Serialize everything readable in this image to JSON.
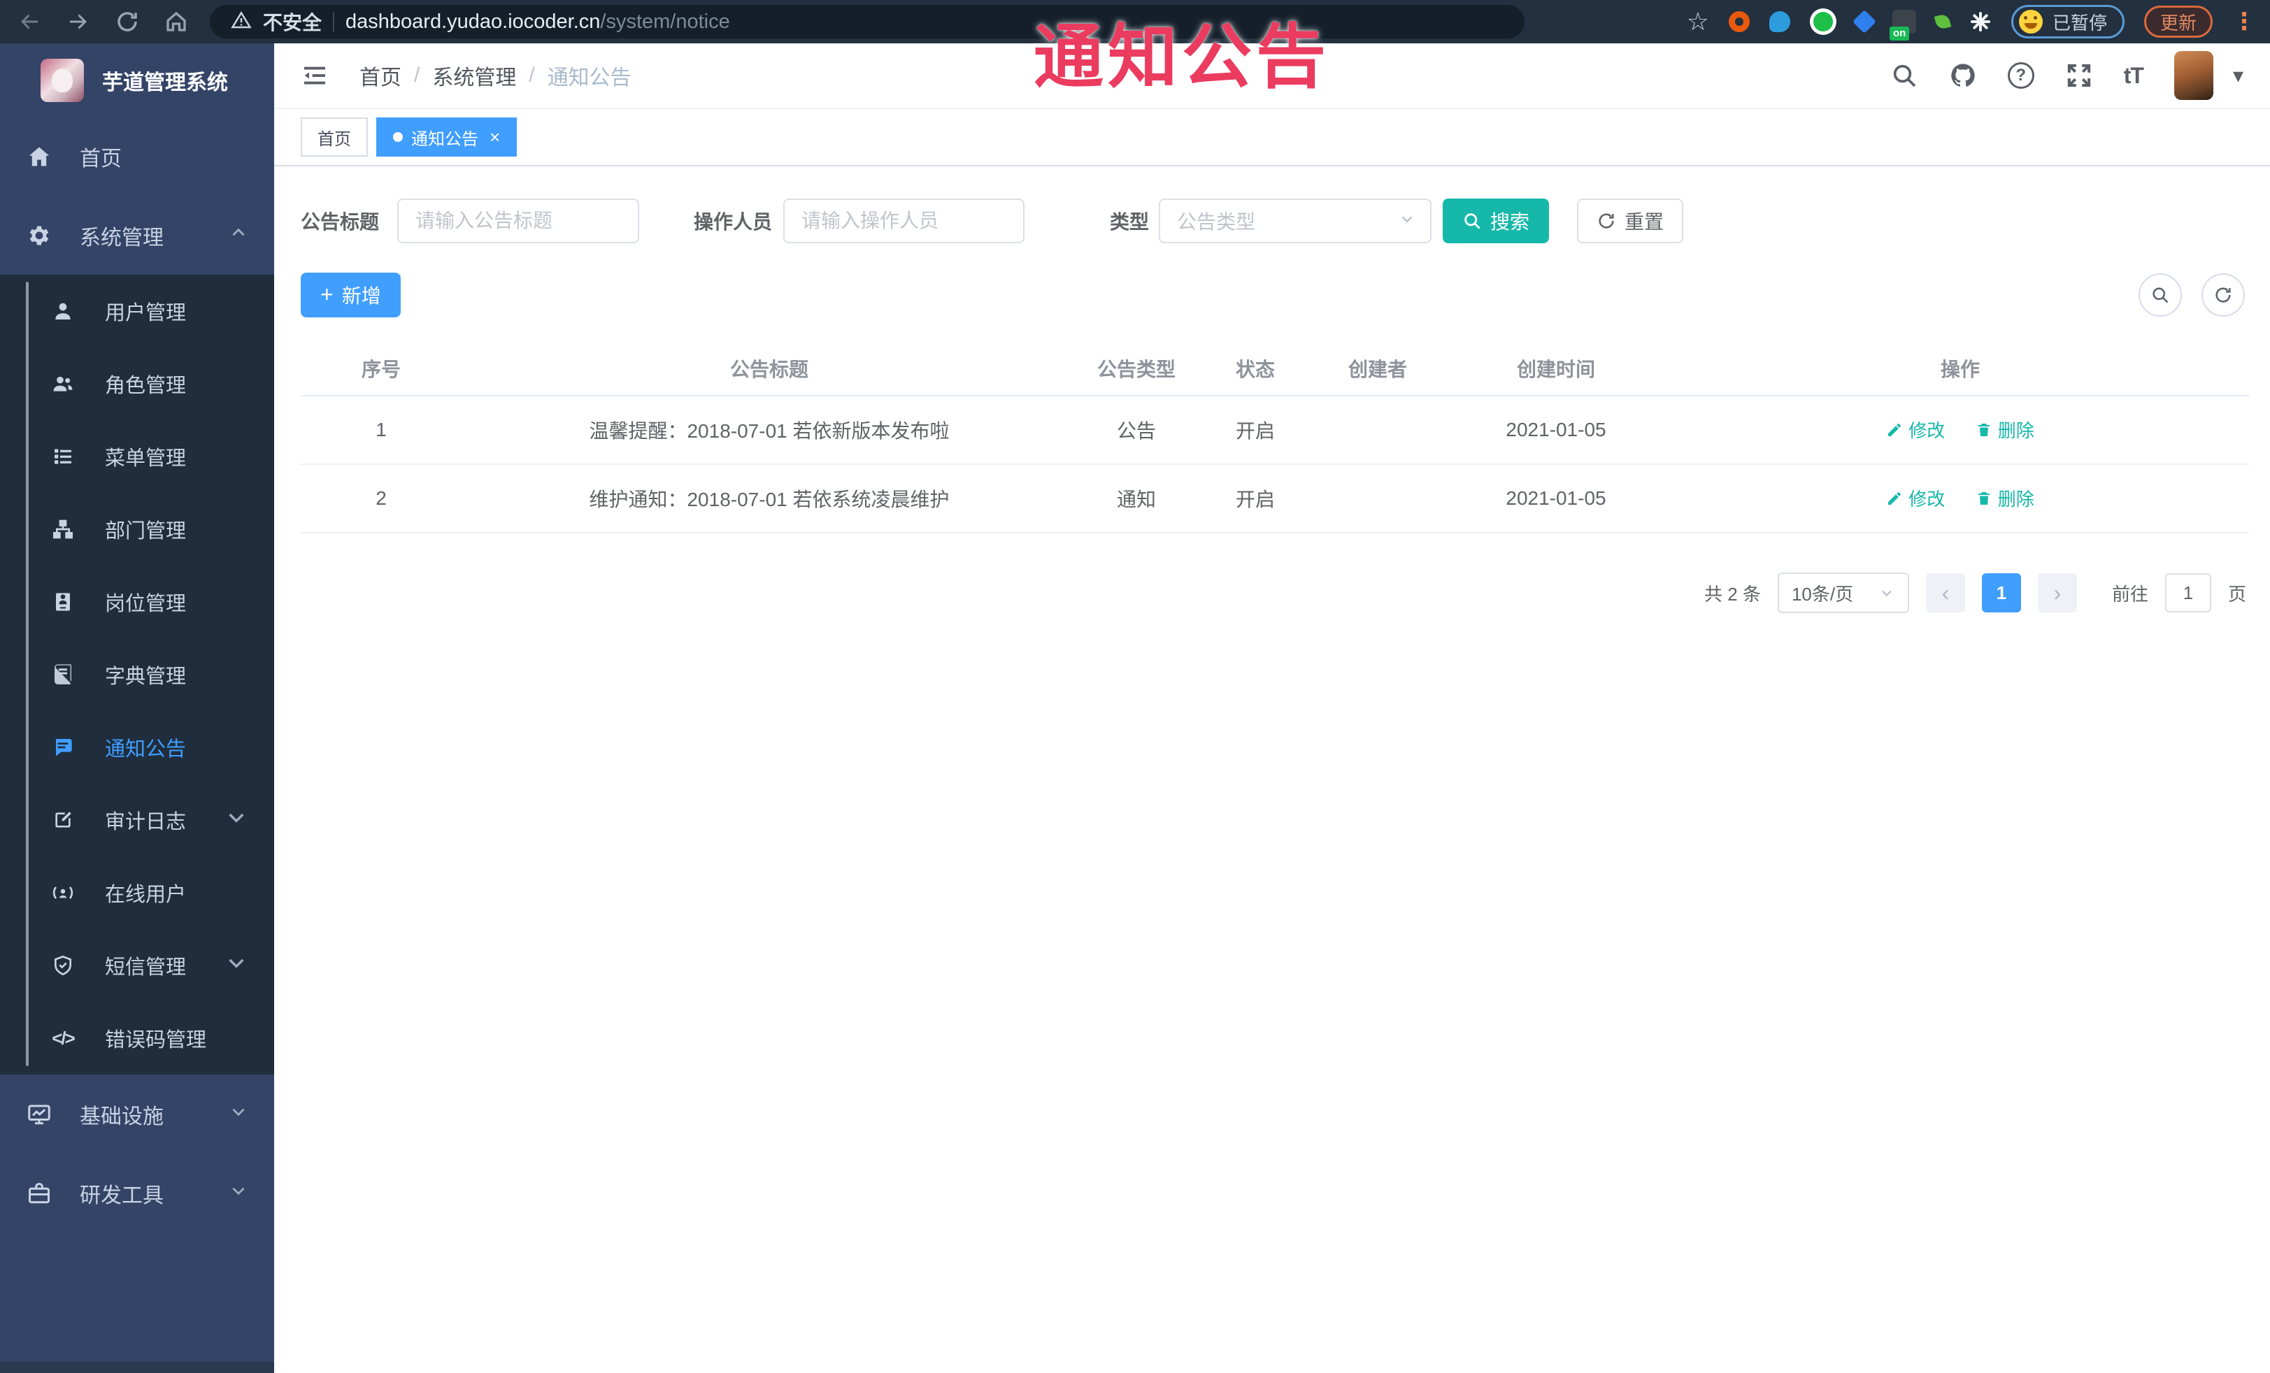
{
  "overlay": {
    "text": "通知公告"
  },
  "browser": {
    "security_label": "不安全",
    "url_host": "dashboard.yudao.iocoder.cn",
    "url_path": "/system/notice",
    "extension_badge": "on",
    "paused_label": "已暂停",
    "update_label": "更新"
  },
  "glyphs": {
    "star": "☆",
    "dots": "⋮",
    "question": "?",
    "font_size": "tT",
    "caret_down": "▾",
    "close": "×",
    "plus": "+",
    "prev": "‹",
    "next": "›",
    "code": "</>",
    "crumb_sep": "/"
  },
  "app": {
    "title": "芋道管理系统"
  },
  "sidebar": {
    "home": "首页",
    "system": "系统管理",
    "sub": [
      "用户管理",
      "角色管理",
      "菜单管理",
      "部门管理",
      "岗位管理",
      "字典管理",
      "通知公告",
      "审计日志",
      "在线用户",
      "短信管理",
      "错误码管理"
    ],
    "infra": "基础设施",
    "devtools": "研发工具"
  },
  "breadcrumb": [
    "首页",
    "系统管理",
    "通知公告"
  ],
  "tabs": [
    {
      "label": "首页"
    },
    {
      "label": "通知公告"
    }
  ],
  "filters": {
    "title_label": "公告标题",
    "title_placeholder": "请输入公告标题",
    "operator_label": "操作人员",
    "operator_placeholder": "请输入操作人员",
    "type_label": "类型",
    "type_placeholder": "公告类型",
    "search_label": "搜索",
    "reset_label": "重置"
  },
  "toolbar": {
    "add_label": "新增"
  },
  "table": {
    "headers": [
      "序号",
      "公告标题",
      "公告类型",
      "状态",
      "创建者",
      "创建时间",
      "操作"
    ],
    "rows": [
      {
        "no": "1",
        "title": "温馨提醒：2018-07-01 若依新版本发布啦",
        "type": "公告",
        "status": "开启",
        "creator": "",
        "created": "2021-01-05",
        "edit": "修改",
        "delete": "删除"
      },
      {
        "no": "2",
        "title": "维护通知：2018-07-01 若依系统凌晨维护",
        "type": "通知",
        "status": "开启",
        "creator": "",
        "created": "2021-01-05",
        "edit": "修改",
        "delete": "删除"
      }
    ]
  },
  "pagination": {
    "total": "共 2 条",
    "page_size": "10条/页",
    "current": "1",
    "goto_label": "前往",
    "goto_value": "1",
    "unit": "页"
  },
  "colors": {
    "primary": "#409EFF",
    "teal": "#16B8AA",
    "overlay_red": "#EB3B5F",
    "sidebar": "#334467",
    "submenu": "#1F2D3D"
  }
}
